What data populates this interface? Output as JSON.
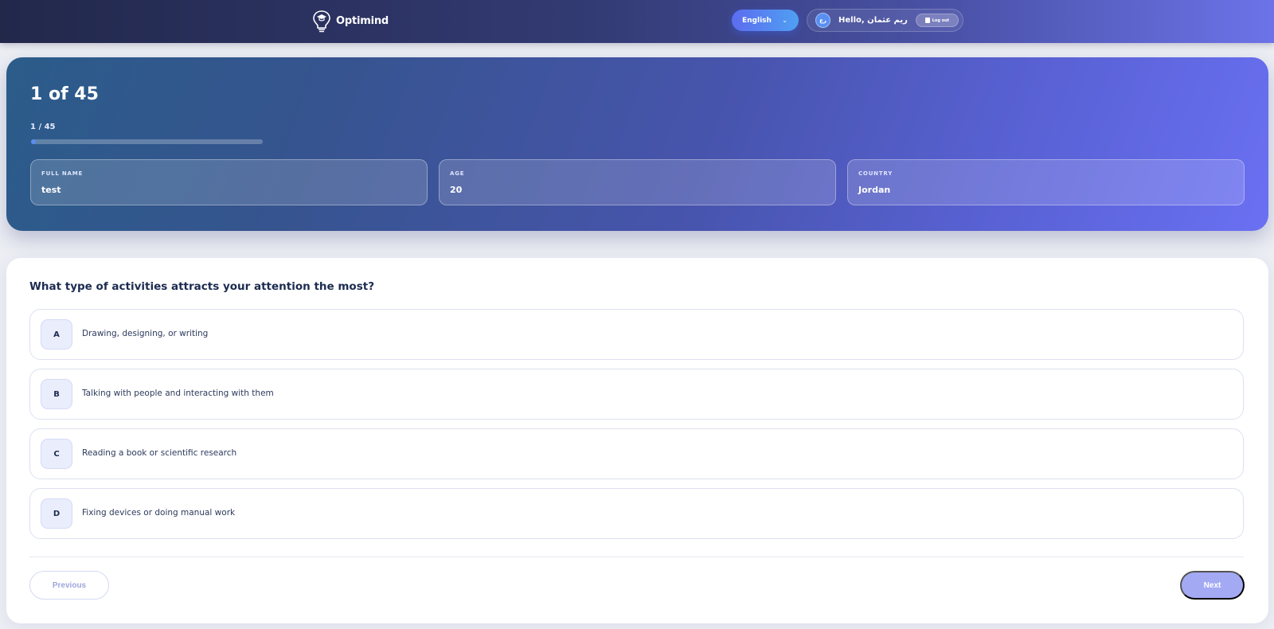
{
  "header": {
    "brand_name": "Optimind",
    "logo_icon": "lightbulb-graduation-cap-icon",
    "language": {
      "selected": "English",
      "icon": "chevron-down-icon"
    },
    "user": {
      "avatar_initials": "رع",
      "greeting": "Hello, ريم عثمان",
      "logout_label": "Log out",
      "logout_icon": "door-exit-icon"
    }
  },
  "hero": {
    "title": "1 of 45",
    "progress_text": "1 / 45",
    "progress": {
      "current": 1,
      "total": 45
    },
    "fields": [
      {
        "label": "FULL NAME",
        "value": "test"
      },
      {
        "label": "AGE",
        "value": "20"
      },
      {
        "label": "COUNTRY",
        "value": "Jordan"
      }
    ]
  },
  "question": {
    "text": "What type of activities attracts your attention the most?",
    "options": [
      {
        "key": "A",
        "text": "Drawing, designing, or writing"
      },
      {
        "key": "B",
        "text": "Talking with people and interacting with them"
      },
      {
        "key": "C",
        "text": "Reading a book or scientific research"
      },
      {
        "key": "D",
        "text": "Fixing devices or doing manual work"
      }
    ]
  },
  "nav": {
    "previous_label": "Previous",
    "next_label": "Next"
  },
  "colors": {
    "accent": "#5b6cf0",
    "next_button": "#a4a9f4",
    "progress_fill": "#5b8cf0"
  }
}
